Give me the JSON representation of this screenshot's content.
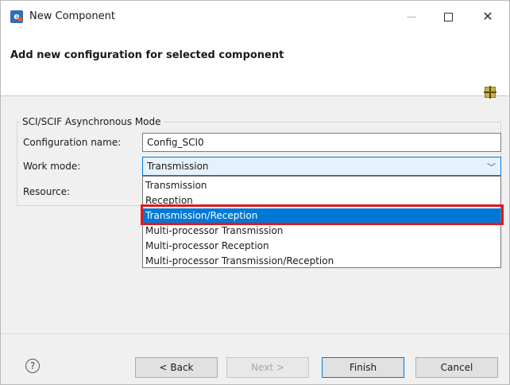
{
  "window": {
    "title": "New Component"
  },
  "header": {
    "title": "Add new configuration for selected component"
  },
  "group": {
    "title": "SCI/SCIF Asynchronous Mode",
    "config_label": "Configuration name:",
    "config_value": "Config_SCI0",
    "work_label": "Work mode:",
    "work_selected": "Transmission",
    "resource_label": "Resource:"
  },
  "dropdown": {
    "options": [
      "Transmission",
      "Reception",
      "Transmission/Reception",
      "Multi-processor Transmission",
      "Multi-processor Reception",
      "Multi-processor Transmission/Reception"
    ],
    "highlighted_index": 2
  },
  "footer": {
    "back": "< Back",
    "next": "Next >",
    "finish": "Finish",
    "cancel": "Cancel"
  },
  "colors": {
    "accent": "#0078d7",
    "highlight_border": "#e0191f"
  }
}
